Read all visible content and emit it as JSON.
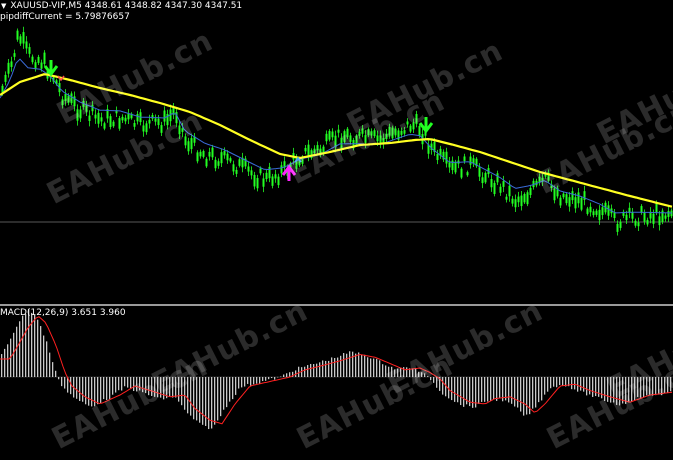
{
  "main_chart": {
    "symbol_info": "XAUUSD-VIP,M5  4348.61 4348.82 4347.30 4347.51",
    "indicator_label": "pipdiffCurrent = 5.79876657"
  },
  "macd_chart": {
    "label": "MACD(12,26,9) 3.651 3.960"
  },
  "watermark": {
    "text": "EAHub.cn"
  },
  "colors": {
    "background": "#000000",
    "candles": "#22ff22",
    "slow_ma": "#ffff22",
    "fast_ma": "#3a6bd8",
    "macd_histogram": "#c8c8c8",
    "macd_signal": "#ff2020",
    "buy_arrow": "#ff22ff",
    "sell_arrow": "#22ff22"
  },
  "icons": {
    "sell_arrow": "down-arrow-icon",
    "buy_arrow": "up-arrow-icon"
  }
}
